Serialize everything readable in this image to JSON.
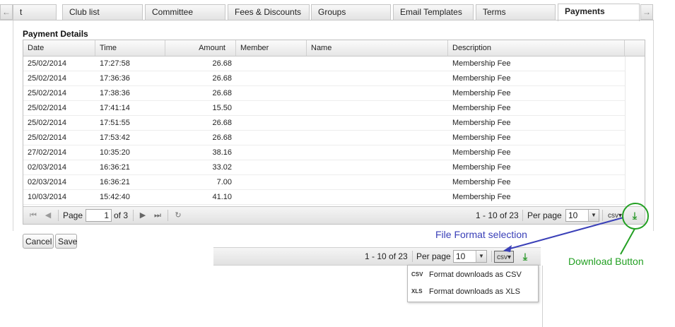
{
  "tabs": [
    {
      "label": "t",
      "active": false
    },
    {
      "label": "Club list",
      "active": false
    },
    {
      "label": "Committee",
      "active": false
    },
    {
      "label": "Fees & Discounts",
      "active": false
    },
    {
      "label": "Groups",
      "active": false
    },
    {
      "label": "Email Templates",
      "active": false
    },
    {
      "label": "Terms",
      "active": false
    },
    {
      "label": "Payments",
      "active": true
    }
  ],
  "tab_scroll": {
    "left_icon": "arrow-left-icon",
    "right_icon": "arrow-right-icon"
  },
  "section_title": "Payment Details",
  "grid": {
    "columns": [
      "Date",
      "Time",
      "Amount",
      "Member",
      "Name",
      "Description"
    ],
    "rows": [
      {
        "date": "25/02/2014",
        "time": "17:27:58",
        "amount": "26.68",
        "member": "",
        "name": "",
        "description": "Membership Fee"
      },
      {
        "date": "25/02/2014",
        "time": "17:36:36",
        "amount": "26.68",
        "member": "",
        "name": "",
        "description": "Membership Fee"
      },
      {
        "date": "25/02/2014",
        "time": "17:38:36",
        "amount": "26.68",
        "member": "",
        "name": "",
        "description": "Membership Fee"
      },
      {
        "date": "25/02/2014",
        "time": "17:41:14",
        "amount": "15.50",
        "member": "",
        "name": "",
        "description": "Membership Fee"
      },
      {
        "date": "25/02/2014",
        "time": "17:51:55",
        "amount": "26.68",
        "member": "",
        "name": "",
        "description": "Membership Fee"
      },
      {
        "date": "25/02/2014",
        "time": "17:53:42",
        "amount": "26.68",
        "member": "",
        "name": "",
        "description": "Membership Fee"
      },
      {
        "date": "27/02/2014",
        "time": "10:35:20",
        "amount": "38.16",
        "member": "",
        "name": "",
        "description": "Membership Fee"
      },
      {
        "date": "02/03/2014",
        "time": "16:36:21",
        "amount": "33.02",
        "member": "",
        "name": "",
        "description": "Membership Fee"
      },
      {
        "date": "02/03/2014",
        "time": "16:36:21",
        "amount": "7.00",
        "member": "",
        "name": "",
        "description": "Membership Fee"
      },
      {
        "date": "10/03/2014",
        "time": "15:42:40",
        "amount": "41.10",
        "member": "",
        "name": "",
        "description": "Membership Fee"
      }
    ]
  },
  "pager": {
    "page_label": "Page",
    "page_value": "1",
    "of_label": "of 3",
    "range_text": "1 - 10 of 23",
    "per_page_label": "Per page",
    "per_page_value": "10",
    "format_value": "csv"
  },
  "buttons": {
    "cancel": "Cancel",
    "save": "Save"
  },
  "zoom_pager": {
    "range_text": "1 - 10 of 23",
    "per_page_label": "Per page",
    "per_page_value": "10",
    "format_value": "csv"
  },
  "format_menu": [
    {
      "tag": "CSV",
      "label": "Format downloads as CSV"
    },
    {
      "tag": "XLS",
      "label": "Format downloads as XLS"
    }
  ],
  "annotations": {
    "file_format": "File Format selection",
    "download": "Download Button"
  },
  "colors": {
    "annotation_blue": "#3a40b8",
    "annotation_green": "#23a023",
    "download_icon": "#2e9a2e"
  }
}
